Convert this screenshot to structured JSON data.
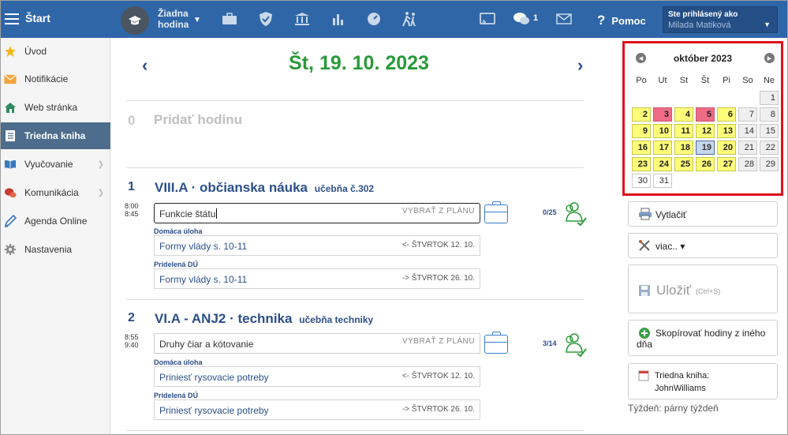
{
  "topbar": {
    "home_label": "Štart",
    "no_lesson": [
      "Žiadna",
      "hodina"
    ],
    "messages_count": "1",
    "help_label": "Pomoc",
    "user_label": "Ste prihlásený ako",
    "user_name": "Milada Matiková"
  },
  "sidebar": {
    "items": [
      {
        "label": "Úvod",
        "icon": "star-icon"
      },
      {
        "label": "Notifikácie",
        "icon": "envelope-icon"
      },
      {
        "label": "Web stránka",
        "icon": "house-icon"
      },
      {
        "label": "Triedna kniha",
        "icon": "notebook-icon"
      },
      {
        "label": "Vyučovanie",
        "icon": "book-icon"
      },
      {
        "label": "Komunikácia",
        "icon": "chat-icon"
      },
      {
        "label": "Agenda Online",
        "icon": "pen-icon"
      },
      {
        "label": "Nastavenia",
        "icon": "gear-icon"
      }
    ]
  },
  "main": {
    "date": "Št, 19. 10. 2023",
    "add_lesson": {
      "num": "0",
      "label": "Pridať hodinu"
    },
    "lessons": [
      {
        "num": "1",
        "time_from": "8:00",
        "time_to": "8:45",
        "title": "VIII.A · občianska náuka",
        "room": "učebňa č.302",
        "topic": "Funkcie štátu",
        "pick_label": "VYBRAŤ Z PLÁNU",
        "attendance": "0/25",
        "homework_label": "Domáca úloha",
        "homework": "Formy vlády s. 10-11",
        "homework_due": "<- ŠTVRTOK 12. 10.",
        "assigned_label": "Pridelená DÚ",
        "assigned": "Formy vlády s. 10-11",
        "assigned_due": "-> ŠTVRTOK 26. 10."
      },
      {
        "num": "2",
        "time_from": "8:55",
        "time_to": "9:40",
        "title": "VI.A - ANJ2 · technika",
        "room": "učebňa techniky",
        "topic": "Druhy čiar a kótovanie",
        "pick_label": "VYBRAŤ Z PLÁNU",
        "attendance": "3/14",
        "homework_label": "Domáca úloha",
        "homework": "Prinies­ť rysovacie potreby",
        "homework_due": "<- ŠTVRTOK 12. 10.",
        "assigned_label": "Pridelená DÚ",
        "assigned": "Priniesť rysovacie potreby",
        "assigned_due": "-> ŠTVRTOK 26. 10."
      }
    ]
  },
  "calendar": {
    "month": "október 2023",
    "weekdays": [
      "Po",
      "Ut",
      "St",
      "Št",
      "Pi",
      "So",
      "Ne"
    ],
    "colors": {
      "lesson_day": "#fdfd7a",
      "holiday": "#f06b86",
      "weekend": "#efefef",
      "today": "#c7d7ec"
    }
  },
  "actions": {
    "print": "Vytlačiť",
    "more": "viac.. ▾",
    "save": "Uložiť",
    "save_shortcut": "(Ctrl+S)",
    "copy_lessons": "Skopírovať hodiny z iného dňa",
    "classbook_label": "Triedna kniha:",
    "classbook_name": "JohnWilliams",
    "week_note": "Týždeň: párny týždeň"
  }
}
